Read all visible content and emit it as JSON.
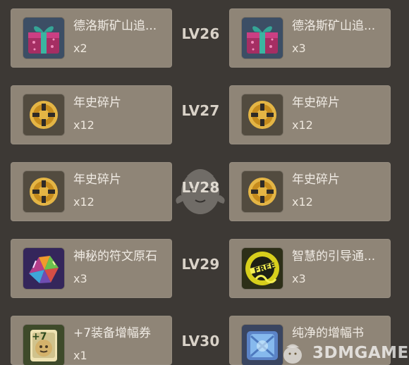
{
  "rows": [
    {
      "level": "LV26",
      "left": {
        "icon": "gift-box-icon",
        "name": "德洛斯矿山追...",
        "qty": "x2"
      },
      "right": {
        "icon": "gift-box-icon",
        "name": "德洛斯矿山追...",
        "qty": "x3"
      }
    },
    {
      "level": "LV27",
      "left": {
        "icon": "coin-fragment-icon",
        "name": "年史碎片",
        "qty": "x12"
      },
      "right": {
        "icon": "coin-fragment-icon",
        "name": "年史碎片",
        "qty": "x12"
      }
    },
    {
      "level": "LV28",
      "left": {
        "icon": "coin-fragment-icon",
        "name": "年史碎片",
        "qty": "x12"
      },
      "right": {
        "icon": "coin-fragment-icon",
        "name": "年史碎片",
        "qty": "x12"
      }
    },
    {
      "level": "LV29",
      "left": {
        "icon": "rune-stone-icon",
        "name": "神秘的符文原石",
        "qty": "x3"
      },
      "right": {
        "icon": "free-guide-icon",
        "name": "智慧的引导通...",
        "qty": "x3"
      }
    },
    {
      "level": "LV30",
      "left": {
        "icon": "plus-seven-scroll-icon",
        "name": "+7装备增幅券",
        "qty": "x1"
      },
      "right": {
        "icon": "amplify-book-icon",
        "name": "纯净的增幅书",
        "qty": ""
      }
    }
  ],
  "watermark": {
    "text": "3DMGAME"
  },
  "colors": {
    "background": "#3d3935",
    "card": "#8f8577",
    "level_text": "#d9d2c8",
    "item_text": "#f0ebe4"
  }
}
